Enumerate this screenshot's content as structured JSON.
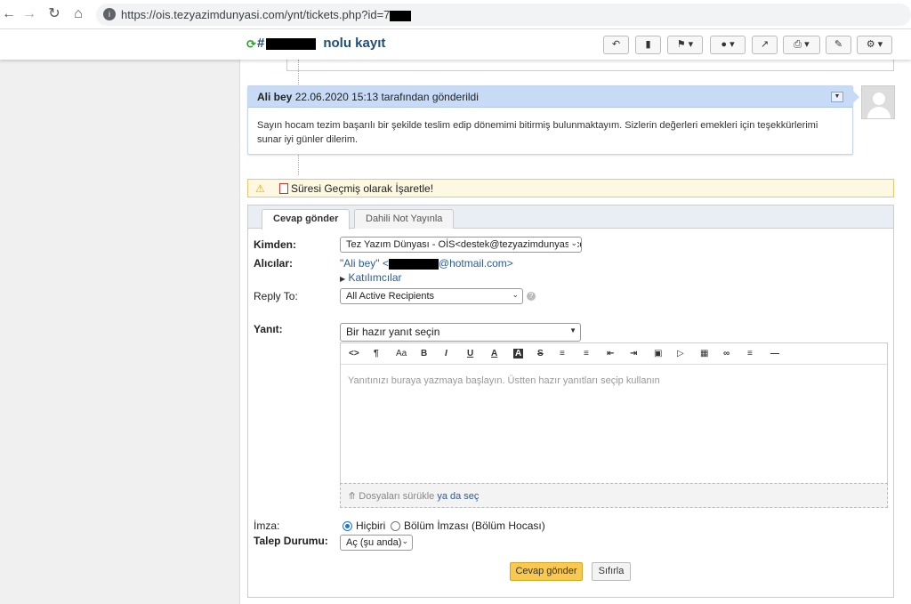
{
  "browser": {
    "url_prefix": "https://ois.tezyazimdunyasi.com/ynt/tickets.php?id=7"
  },
  "ticket": {
    "title_prefix": "#",
    "title_suffix": "nolu kayıt"
  },
  "thread": {
    "author": "Ali bey",
    "timestamp_text": "22.06.2020 15:13 tarafından gönderildi",
    "body": "Sayın hocam tezim başarılı bir şekilde teslim edip dönemimi bitirmiş bulunmaktayım. Sizlerin değerleri emekleri için teşekkürlerimi sunar iyi günler dilerim."
  },
  "overdue": {
    "label": "Süresi Geçmiş olarak İşaretle!"
  },
  "reply": {
    "tabs": [
      "Cevap gönder",
      "Dahili Not Yayınla"
    ],
    "from_label": "Kimden:",
    "from_value": "Tez Yazım Dünyası - OİS<destek@tezyazimdunyasi.co",
    "recipients_label": "Alıcılar:",
    "recipient_prefix": "\"Ali bey\" <",
    "recipient_suffix": "@hotmail.com>",
    "collaborators_label": "Katılımcılar",
    "reply_to_label": "Reply To:",
    "reply_to_value": "All Active Recipients",
    "response_label": "Yanıt:",
    "canned_placeholder": "Bir hazır yanıt seçin",
    "editor_placeholder": "Yanıtınızı buraya yazmaya başlayın. Üstten hazır yanıtları seçip kullanın",
    "dropzone_text": "Dosyaları sürükle",
    "dropzone_link": "ya da seç",
    "signature_label": "İmza:",
    "signature_options": [
      "Hiçbiri",
      "Bölüm İmzası (Bölüm Hocası)"
    ],
    "status_label": "Talep Durumu:",
    "status_value": "Aç (şu anda)",
    "submit_label": "Cevap gönder",
    "reset_label": "Sıfırla"
  },
  "editor_toolbar": [
    "<>",
    "¶",
    "Aa",
    "B",
    "I",
    "U",
    "A",
    "A",
    "S",
    "list-bullet",
    "list-number",
    "outdent",
    "indent",
    "image",
    "video",
    "table",
    "link",
    "align",
    "hr"
  ],
  "colors": {
    "accent": "#f9c94f",
    "message_header": "#c7dbf7",
    "warning_bg": "#fcf8e1",
    "link": "#2a5c9a"
  }
}
